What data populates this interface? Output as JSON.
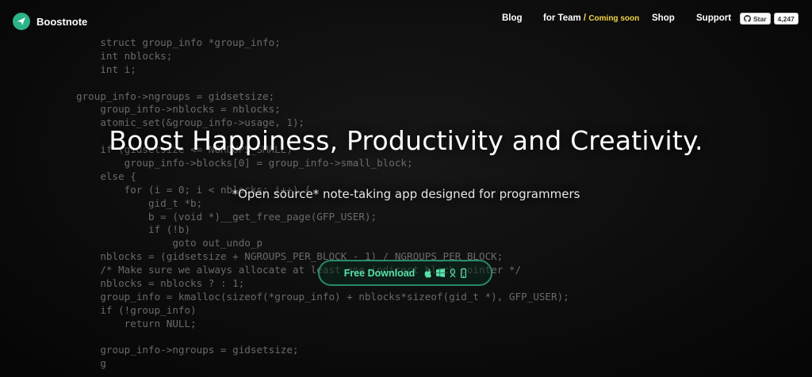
{
  "header": {
    "brand": "Boostnote",
    "nav": {
      "blog": "Blog",
      "team": "for Team",
      "team_separator": "/",
      "team_badge": "Coming soon",
      "shop": "Shop",
      "support": "Support"
    },
    "github": {
      "star_label": "Star",
      "star_count": "4,247"
    }
  },
  "hero": {
    "title": "Boost Happiness, Productivity and Creativity.",
    "subtitle": "*Open source* note-taking app designed for programmers",
    "cta_label": "Free Download",
    "cta_icons": [
      "apple-icon",
      "windows-icon",
      "linux-icon",
      "mobile-icon"
    ]
  },
  "background_code": [
    "    struct group_info *group_info;",
    "    int nblocks;",
    "    int i;",
    "",
    "group_info->ngroups = gidsetsize;",
    "    group_info->nblocks = nblocks;",
    "    atomic_set(&group_info->usage, 1);",
    "",
    "    if (gidsetsize <= NGROUPS_SMALL)",
    "        group_info->blocks[0] = group_info->small_block;",
    "    else {",
    "        for (i = 0; i < nblocks; i++) {",
    "            gid_t *b;",
    "            b = (void *)__get_free_page(GFP_USER);",
    "            if (!b)",
    "                goto out_undo_p",
    "    nblocks = (gidsetsize + NGROUPS_PER_BLOCK - 1) / NGROUPS_PER_BLOCK;",
    "    /* Make sure we always allocate at least one indirect block pointer */",
    "    nblocks = nblocks ? : 1;",
    "    group_info = kmalloc(sizeof(*group_info) + nblocks*sizeof(gid_t *), GFP_USER);",
    "    if (!group_info)",
    "        return NULL;",
    "",
    "    group_info->ngroups = gidsetsize;",
    "    g"
  ],
  "colors": {
    "accent": "#2bb38a",
    "cta_text": "#56e0a8",
    "badge": "#f5d547"
  }
}
